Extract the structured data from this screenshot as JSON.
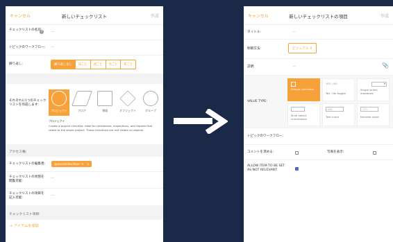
{
  "left": {
    "header": {
      "cancel": "キャンセル",
      "title": "新しいチェックリスト",
      "create": "作成"
    },
    "name_label": "チェックリストの名前:",
    "topic_label": "トピックのワークフロー:",
    "repeat_label": "繰り返し:",
    "repeat_options": [
      "繰り返しなし",
      "日ごと",
      "週ごと",
      "月ごと",
      "年ごと"
    ],
    "create_for_label": "それぞれに1つのチェックリストを作成します:",
    "types": [
      {
        "icon": "globe-icon",
        "name": "プロジェクト",
        "selected": true
      },
      {
        "icon": "floor-icon",
        "name": "フロア"
      },
      {
        "icon": "area-icon",
        "name": "領域"
      },
      {
        "icon": "object-icon",
        "name": "オブジェクト"
      },
      {
        "icon": "group-icon",
        "name": "グループ"
      }
    ],
    "type_title": "プロジェクト",
    "type_desc": "Create a project checklist. Ideal for milestones, inspections, and reports that relate to the whole project. These checklists are not visible on objects.",
    "access_section": "アクセス権:",
    "editors_label": "チェックリストの編集者:",
    "editor_chip": "@susankdavidson ✎",
    "editor_chip_close": "×",
    "state_label": "チェックリストの状態を閲覧可能:",
    "items_label": "チェックリストの項目を記入可能:",
    "items_section": "チェックリスト項目:",
    "add_item": "+ アイテムを追加",
    "dash": "—"
  },
  "right": {
    "header": {
      "cancel": "キャンセル",
      "title": "新しいチェックリストの項目",
      "create": "作成"
    },
    "title_label": "タイトル:",
    "format_label": "制御方法:",
    "format_value": "ビジュアル ⇕",
    "desc_label": "説明:",
    "value_type_label": "VALUE TYPE:",
    "value_types": [
      {
        "name": "Simple checkbox",
        "selected": true
      },
      {
        "name": "Yes / No toggle",
        "top": "YES / NO"
      },
      {
        "name": "Single select dropdown",
        "top": "▾"
      },
      {
        "name": "Multi select checkboxes"
      },
      {
        "name": "Text input",
        "top": "ABC"
      },
      {
        "name": "Number input",
        "top": "123"
      }
    ],
    "topic_label": "トピックのワークフロー:",
    "require_comment_label": "コメントを求める:",
    "show_photo_label": "写真を表示:",
    "allow_not_relevant_label": "ALLOW ITEM TO BE SET AS NOT RELEVANT:",
    "allow_not_relevant": true,
    "dash": "—"
  },
  "colors": {
    "accent": "#f7a13a",
    "background": "#1b2948"
  }
}
